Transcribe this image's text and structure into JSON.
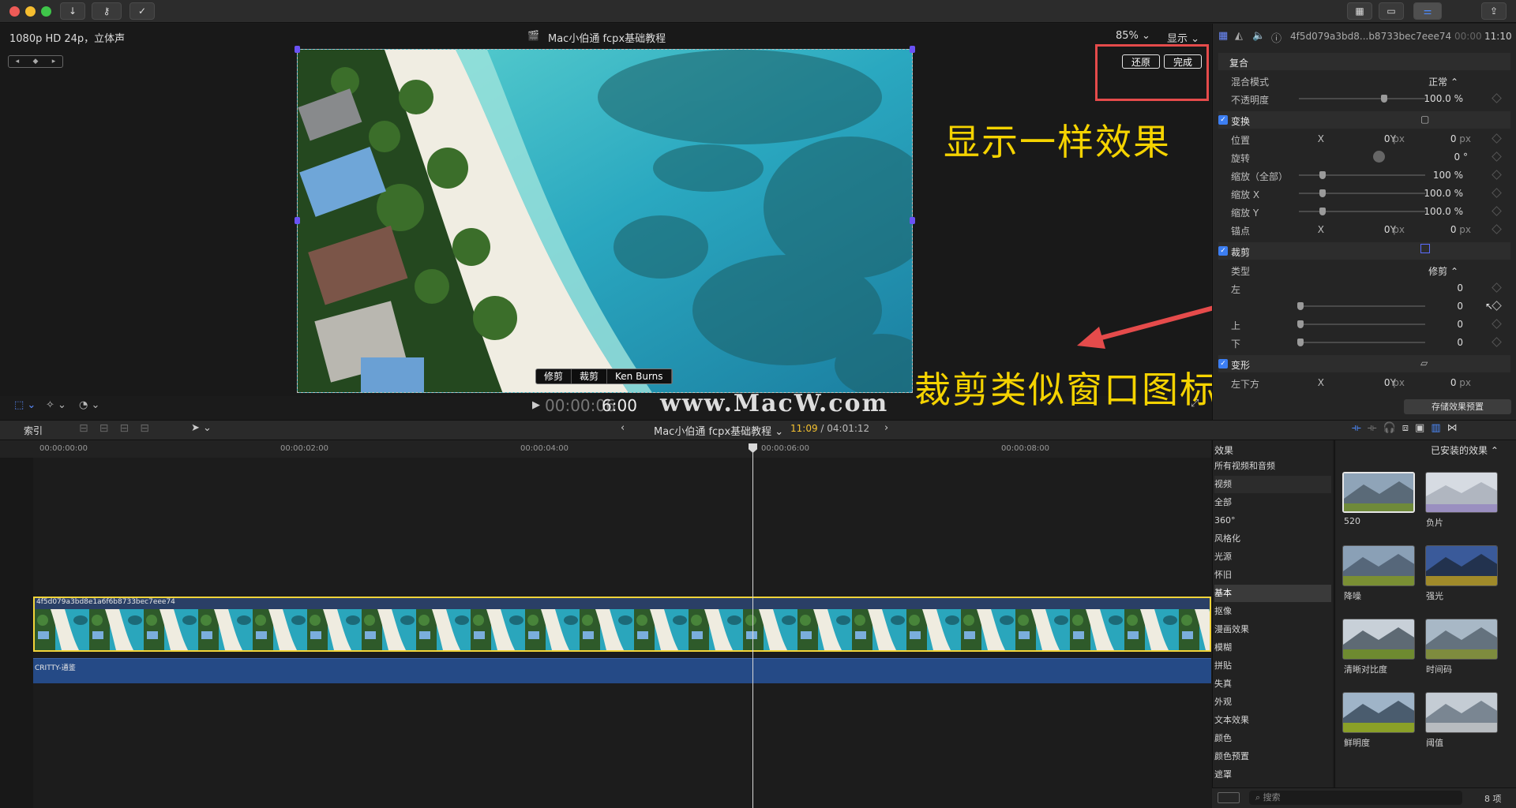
{
  "viewer": {
    "format": "1080p HD 24p，立体声",
    "project_title": "Mac小伯通 fcpx基础教程",
    "zoom": "85%",
    "view_label": "显示",
    "reset_label": "还原",
    "done_label": "完成",
    "modes": [
      "修剪",
      "裁剪",
      "Ken Burns"
    ],
    "timecode": "00:00:06",
    "timecode_overlay": "6:00",
    "watermark": "www.MacW.com"
  },
  "annotations": {
    "top": "显示一样效果",
    "bottom": "裁剪类似窗口图标"
  },
  "inspector": {
    "clip_name": "4f5d079a3bd8...b8733bec7eee74",
    "time_prefix": "00:00",
    "duration": "11:10",
    "unit": "px",
    "compositing": {
      "title": "复合",
      "blend_label": "混合模式",
      "blend_value": "正常",
      "opacity_label": "不透明度",
      "opacity_value": "100.0 %"
    },
    "transform": {
      "title": "变换",
      "position_label": "位置",
      "position_x": "0",
      "position_y": "0",
      "rotation_label": "旋转",
      "rotation_value": "0 °",
      "scale_all_label": "缩放（全部）",
      "scale_all_value": "100 %",
      "scale_x_label": "缩放 X",
      "scale_x_value": "100.0 %",
      "scale_y_label": "缩放 Y",
      "scale_y_value": "100.0 %",
      "anchor_label": "锚点",
      "anchor_x": "0",
      "anchor_y": "0"
    },
    "crop": {
      "title": "裁剪",
      "type_label": "类型",
      "type_value": "修剪",
      "left_label": "左",
      "left_value": "0",
      "right_value": "0",
      "top_label": "上",
      "top_value": "0",
      "bottom_label": "下",
      "bottom_value": "0"
    },
    "distort": {
      "title": "变形",
      "bottom_left_label": "左下方",
      "bottom_left_x": "0",
      "bottom_left_y": "0"
    },
    "save_preset": "存储效果预置"
  },
  "timeline": {
    "index_label": "索引",
    "project_name": "Mac小伯通 fcpx基础教程",
    "position": "11:09",
    "duration": "04:01:12",
    "ruler": [
      "00:00:00:00",
      "00:00:02:00",
      "00:00:04:00",
      "00:00:06:00",
      "00:00:08:00"
    ],
    "video_clip": "4f5d079a3bd8e1a6f6b8733bec7eee74",
    "audio_clip": "CRITTY-通鉴"
  },
  "browser": {
    "title": "效果",
    "filter": "已安装的效果",
    "categories": [
      "所有视频和音频",
      "视频",
      "全部",
      "360°",
      "风格化",
      "光源",
      "怀旧",
      "基本",
      "抠像",
      "漫画效果",
      "模糊",
      "拼贴",
      "失真",
      "外观",
      "文本效果",
      "颜色",
      "颜色预置",
      "遮罩"
    ],
    "selected_category": "基本",
    "effects": [
      "520",
      "负片",
      "降噪",
      "强光",
      "清晰对比度",
      "时间码",
      "鲜明度",
      "阈值"
    ],
    "search_placeholder": "搜索",
    "count": "8 项"
  }
}
